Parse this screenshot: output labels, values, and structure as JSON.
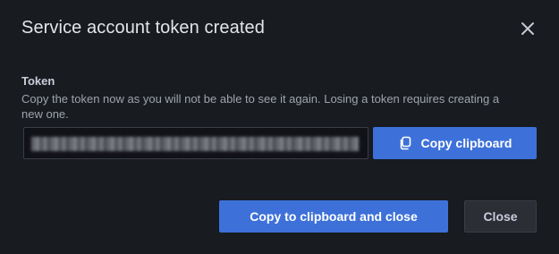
{
  "modal": {
    "title": "Service account token created",
    "close_icon": "close-icon"
  },
  "token": {
    "label": "Token",
    "description": "Copy the token now as you will not be able to see it again. Losing a token requires creating a new one.",
    "value_hidden": true
  },
  "buttons": {
    "copy_label": "Copy clipboard",
    "copy_icon": "copy-icon",
    "copy_close_label": "Copy to clipboard and close",
    "close_label": "Close"
  },
  "colors": {
    "background": "#181b1f",
    "primary": "#3d71d9",
    "secondary": "#2b2e35"
  }
}
